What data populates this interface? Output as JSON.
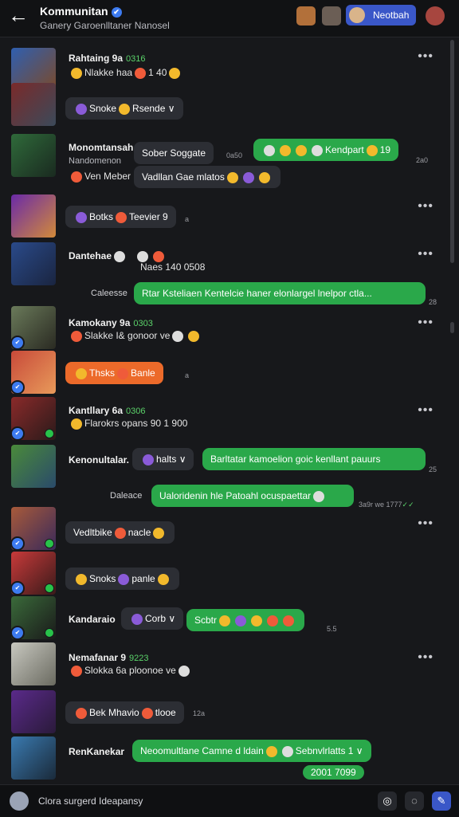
{
  "header": {
    "back_glyph": "←",
    "title": "Kommunitan",
    "verified_glyph": "✔",
    "subtitle": "Ganery Garoenlltaner Nanosel",
    "button_label": "Neotbah"
  },
  "messages": [
    {
      "name": "Rahtaing 9a",
      "ts": "0316",
      "line": "Nlakke haa",
      "line_tail": "1 40"
    },
    {
      "pill": "Snoke",
      "pill_tail": "Rsende ∨"
    },
    {
      "name": "Monomtansah",
      "sub": "Nandomenon",
      "pill": "Sober Soggate",
      "aside": "0a50",
      "green": "Kendpart",
      "green_tail": "19",
      "line": "Ven Meber",
      "line2": "Vadllan Gae mlatos",
      "tiny": "2a0"
    },
    {
      "pill": "Botks",
      "pill_mid": "Teevier",
      "pill_tail": "9",
      "tiny": "a"
    },
    {
      "name": "Dantehae",
      "line": "Naes 140 0508",
      "aside": "Caleesse",
      "green": "Rtar Ksteliaen Kentelcie haner elonlargel lnelpor ctla...",
      "tiny": "28"
    },
    {
      "name": "Kamokany 9a",
      "ts": "0303",
      "line": "Slakke I& gonoor ve"
    },
    {
      "pill": "Thsks",
      "pill_tail": "Banle",
      "tiny": "a"
    },
    {
      "name": "Kantllary 6a",
      "ts": "0306",
      "line": "Flarokrs opans 90",
      "line_tail": "1 900"
    },
    {
      "name": "Kenonultalar.",
      "pill": "halts",
      "green": "Barltatar kamoelion goic kenllant pauurs",
      "tiny": "25"
    },
    {
      "aside": "Daleace",
      "green": "Ualoridenin hle Patoahl ocuspaettar",
      "tiny": "3a9r we 1777",
      "tiny_check": "✓✓"
    },
    {
      "pill": "Vedltbike",
      "pill_tail": "nacle"
    },
    {
      "pill": "Snoks",
      "pill_tail": "panle"
    },
    {
      "name": "Kandaraio",
      "pill": "Corb",
      "green": "Scbtr",
      "tiny": "5.5"
    },
    {
      "name": "Nemafanar 9",
      "ts": "9223",
      "line": "Slokka 6a ploonoe ve"
    },
    {
      "pill": "Bek Mhavio",
      "pill_tail": "tlooe",
      "tiny": "12a"
    },
    {
      "name": "RenKanekar",
      "green": "Neoomultlane Camne d ldain",
      "green_tail": "Sebnvlrlatts 1 ∨",
      "tiny": "2001 7099"
    }
  ],
  "more_glyph": "•••",
  "footer": {
    "text": "Clora surgerd Ideapansy",
    "icon1": "◎",
    "icon2": "◌",
    "icon3": "✎"
  }
}
